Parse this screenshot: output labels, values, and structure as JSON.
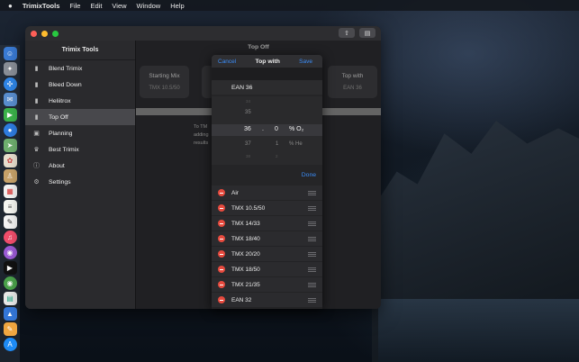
{
  "menubar": {
    "apple": "",
    "app_name": "TrimixTools",
    "items": [
      "File",
      "Edit",
      "View",
      "Window",
      "Help"
    ]
  },
  "sidebar": {
    "title": "Trimix Tools",
    "items": [
      {
        "label": "Blend Trimix",
        "icon": "tank-icon"
      },
      {
        "label": "Bleed Down",
        "icon": "tank-icon"
      },
      {
        "label": "Heliitrox",
        "icon": "tank-icon"
      },
      {
        "label": "Top Off",
        "icon": "tank-icon"
      },
      {
        "label": "Planning",
        "icon": "planning-icon"
      },
      {
        "label": "Best Trimix",
        "icon": "trophy-icon"
      },
      {
        "label": "About",
        "icon": "info-icon"
      },
      {
        "label": "Settings",
        "icon": "gear-icon"
      }
    ],
    "selected": "Top Off"
  },
  "detail": {
    "title": "Top Off",
    "starting_mix_label": "Starting Mix",
    "starting_mix_value": "TMX 10.5/50",
    "top_with_label": "Top with",
    "top_with_value": "EAN 36",
    "dim_text": [
      "To TM",
      "adding",
      "results"
    ]
  },
  "sheet": {
    "cancel": "Cancel",
    "title": "Top with",
    "save": "Save",
    "selected_gas": "EAN 36",
    "picker": {
      "o2_above_far": "34",
      "o2_above": "35",
      "o2_selected": "36",
      "o2_below": "37",
      "o2_below_far": "38",
      "dot": ".",
      "decimal_selected": "0",
      "decimal_below": "1",
      "decimal_below_far": "2",
      "o2_unit": "% O₂",
      "he_unit": "% He"
    },
    "done": "Done",
    "gases": [
      "Air",
      "TMX 10.5/50",
      "TMX 14/33",
      "TMX 18/40",
      "TMX 20/20",
      "TMX 18/50",
      "TMX 21/35",
      "EAN 32"
    ]
  },
  "colors": {
    "accent": "#3b8cf6",
    "delete": "#e64a3e",
    "selected_row": "#48484c"
  }
}
